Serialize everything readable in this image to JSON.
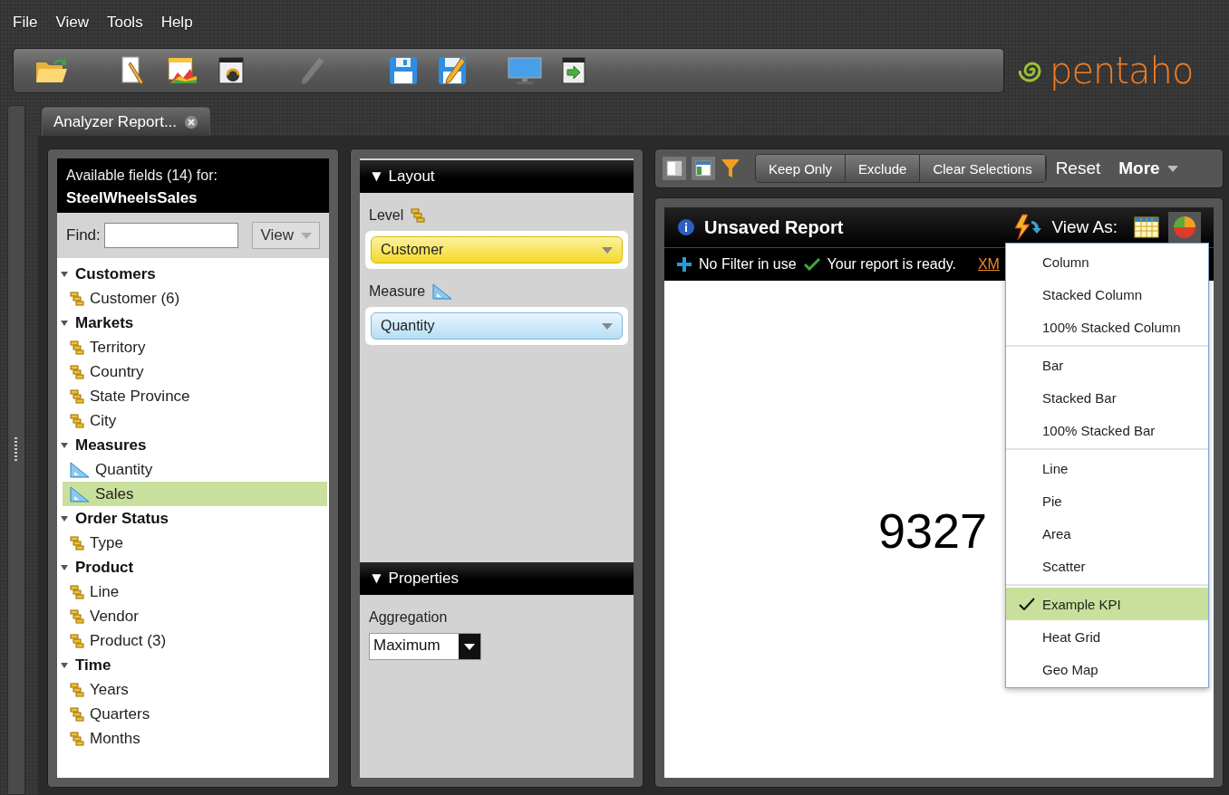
{
  "menu_bar": [
    "File",
    "View",
    "Tools",
    "Help"
  ],
  "toolbar": [
    {
      "kind": "open",
      "disabled": false
    },
    {
      "kind": "report",
      "disabled": false
    },
    {
      "kind": "chart",
      "disabled": false
    },
    {
      "kind": "dashboard",
      "disabled": false
    },
    {
      "kind": "edit",
      "disabled": true
    },
    {
      "kind": "save",
      "disabled": false
    },
    {
      "kind": "save-as",
      "disabled": false
    },
    {
      "kind": "present",
      "disabled": false
    },
    {
      "kind": "export",
      "disabled": false
    }
  ],
  "logo": "pentaho",
  "tabs": [
    {
      "label": "Analyzer Report...",
      "selected": true
    }
  ],
  "fields_panel": {
    "title": "Available fields (14) for:",
    "cube": "SteelWheelsSales",
    "find_label": "Find:",
    "view_button": "View",
    "groups": [
      {
        "label": "Customers",
        "expanded": true,
        "children": [
          {
            "label": "Customer (6)",
            "kind": "level",
            "selected": false
          }
        ]
      },
      {
        "label": "Markets",
        "expanded": true,
        "children": [
          {
            "label": "Territory",
            "kind": "level",
            "selected": false
          },
          {
            "label": "Country",
            "kind": "level",
            "selected": false
          },
          {
            "label": "State Province",
            "kind": "level",
            "selected": false
          },
          {
            "label": "City",
            "kind": "level",
            "selected": false
          }
        ]
      },
      {
        "label": "Measures",
        "expanded": true,
        "children": [
          {
            "label": "Quantity",
            "kind": "measure",
            "selected": false
          },
          {
            "label": "Sales",
            "kind": "measure",
            "selected": true
          }
        ]
      },
      {
        "label": "Order Status",
        "expanded": true,
        "children": [
          {
            "label": "Type",
            "kind": "level",
            "selected": false
          }
        ]
      },
      {
        "label": "Product",
        "expanded": true,
        "children": [
          {
            "label": "Line",
            "kind": "level",
            "selected": false
          },
          {
            "label": "Vendor",
            "kind": "level",
            "selected": false
          },
          {
            "label": "Product (3)",
            "kind": "level",
            "selected": false
          }
        ]
      },
      {
        "label": "Time",
        "expanded": true,
        "children": [
          {
            "label": "Years",
            "kind": "level",
            "selected": false
          },
          {
            "label": "Quarters",
            "kind": "level",
            "selected": false
          },
          {
            "label": "Months",
            "kind": "level",
            "selected": false
          }
        ]
      }
    ]
  },
  "layout_panel": {
    "title": "▼ Layout",
    "level_label": "Level",
    "level_value": "Customer",
    "measure_label": "Measure",
    "measure_value": "Quantity",
    "properties_title": "▼ Properties",
    "aggregation_label": "Aggregation",
    "aggregation_value": "Maximum"
  },
  "report_toolbar": {
    "buttons": [
      "Keep Only",
      "Exclude",
      "Clear Selections"
    ],
    "reset": "Reset",
    "more": "More"
  },
  "report": {
    "title": "Unsaved Report",
    "view_as": "View As:",
    "filter_text": "No Filter in use",
    "status": "Your report is ready.",
    "link": "XM",
    "value": "9327"
  },
  "chart_menu": {
    "sections": [
      {
        "items": [
          {
            "label": "Column",
            "selected": false
          },
          {
            "label": "Stacked Column",
            "selected": false
          },
          {
            "label": "100% Stacked Column",
            "selected": false
          }
        ]
      },
      {
        "items": [
          {
            "label": "Bar",
            "selected": false
          },
          {
            "label": "Stacked Bar",
            "selected": false
          },
          {
            "label": "100% Stacked Bar",
            "selected": false
          }
        ]
      },
      {
        "items": [
          {
            "label": "Line",
            "selected": false
          },
          {
            "label": "Pie",
            "selected": false
          },
          {
            "label": "Area",
            "selected": false
          },
          {
            "label": "Scatter",
            "selected": false
          }
        ]
      },
      {
        "items": [
          {
            "label": "Example KPI",
            "selected": true
          },
          {
            "label": "Heat Grid",
            "selected": false
          },
          {
            "label": "Geo Map",
            "selected": false
          }
        ]
      }
    ]
  }
}
